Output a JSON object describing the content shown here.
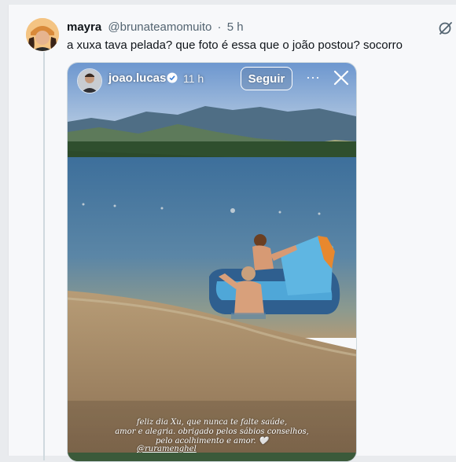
{
  "tweet": {
    "display_name": "mayra",
    "handle": "@brunateamomuito",
    "separator": "·",
    "time": "5 h",
    "text": "a xuxa tava pelada? que foto é essa que o joão postou? socorro"
  },
  "story": {
    "username": "joao.lucas",
    "time": "11 h",
    "follow_label": "Seguir",
    "more_label": "···",
    "caption_lines": [
      "feliz dia Xu, que nunca te falte saúde,",
      "amor e alegria. obrigado pelos sábios conselhos,",
      "pelo acolhimento e amor. 🤍"
    ],
    "mention": "@ruramenghel"
  },
  "icons": {
    "avatar": "user-avatar",
    "grok": "grok-icon",
    "verified": "verified-badge-icon",
    "more": "more-options-icon",
    "close": "close-icon"
  },
  "colors": {
    "text_primary": "#0f1419",
    "text_secondary": "#536471",
    "thread_line": "#cfd9de"
  }
}
